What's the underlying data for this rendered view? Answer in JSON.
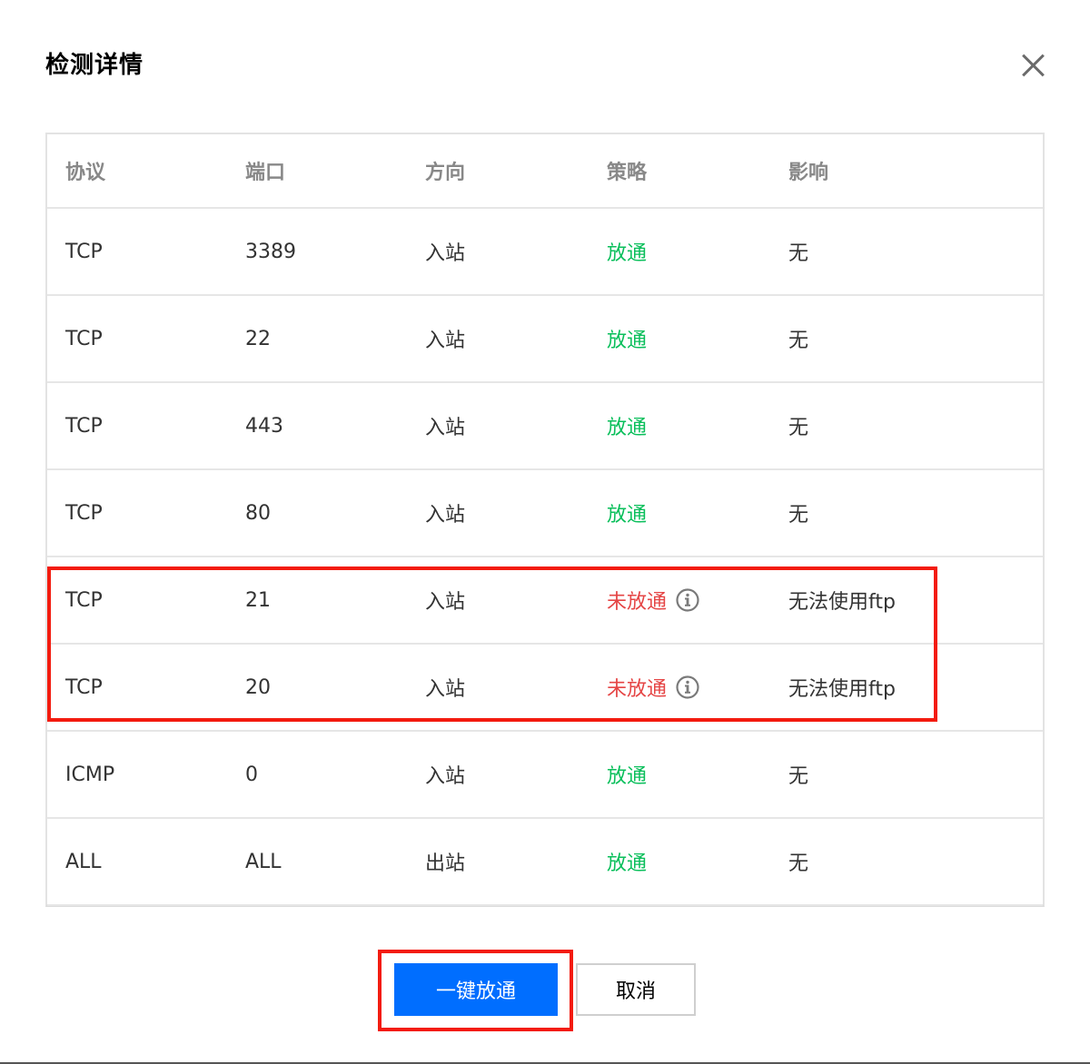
{
  "dialog": {
    "title": "检测详情",
    "close_icon": "close-icon"
  },
  "table": {
    "headers": [
      "协议",
      "端口",
      "方向",
      "策略",
      "影响"
    ],
    "rows": [
      {
        "protocol": "TCP",
        "port": "3389",
        "direction": "入站",
        "policy": "放通",
        "policy_status": "ok",
        "impact": "无"
      },
      {
        "protocol": "TCP",
        "port": "22",
        "direction": "入站",
        "policy": "放通",
        "policy_status": "ok",
        "impact": "无"
      },
      {
        "protocol": "TCP",
        "port": "443",
        "direction": "入站",
        "policy": "放通",
        "policy_status": "ok",
        "impact": "无"
      },
      {
        "protocol": "TCP",
        "port": "80",
        "direction": "入站",
        "policy": "放通",
        "policy_status": "ok",
        "impact": "无"
      },
      {
        "protocol": "TCP",
        "port": "21",
        "direction": "入站",
        "policy": "未放通",
        "policy_status": "blocked",
        "impact": "无法使用ftp"
      },
      {
        "protocol": "TCP",
        "port": "20",
        "direction": "入站",
        "policy": "未放通",
        "policy_status": "blocked",
        "impact": "无法使用ftp"
      },
      {
        "protocol": "ICMP",
        "port": "0",
        "direction": "入站",
        "policy": "放通",
        "policy_status": "ok",
        "impact": "无"
      },
      {
        "protocol": "ALL",
        "port": "ALL",
        "direction": "出站",
        "policy": "放通",
        "policy_status": "ok",
        "impact": "无"
      }
    ]
  },
  "footer": {
    "primary_label": "一键放通",
    "cancel_label": "取消"
  },
  "colors": {
    "ok": "#0abf5b",
    "blocked": "#e54545",
    "primary": "#006eff",
    "highlight": "#f31b0f"
  }
}
